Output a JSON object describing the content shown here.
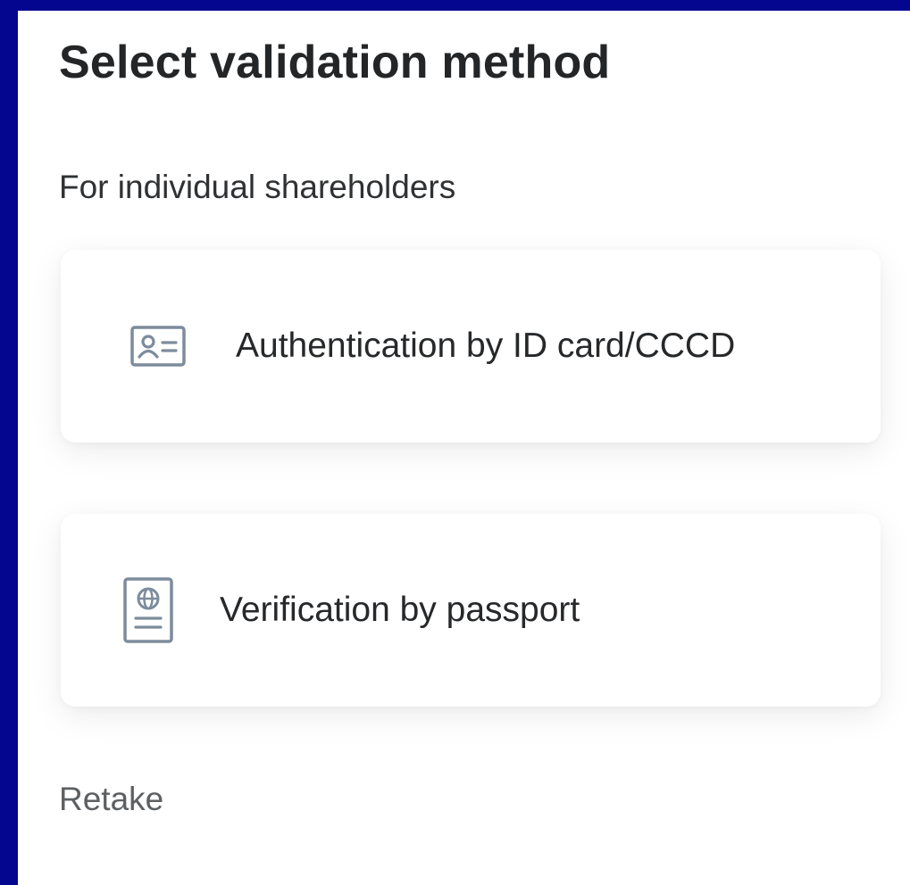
{
  "header": {
    "title": "Select validation method"
  },
  "section": {
    "label": "For individual shareholders"
  },
  "options": [
    {
      "label": "Authentication by ID card/CCCD",
      "icon": "id-card-icon"
    },
    {
      "label": "Verification by passport",
      "icon": "passport-icon"
    }
  ],
  "footer": {
    "retake_label": "Retake"
  },
  "colors": {
    "frame": "#04068f",
    "icon": "#7d8c9c",
    "title_text": "#232527",
    "secondary_text": "#5d6063"
  }
}
